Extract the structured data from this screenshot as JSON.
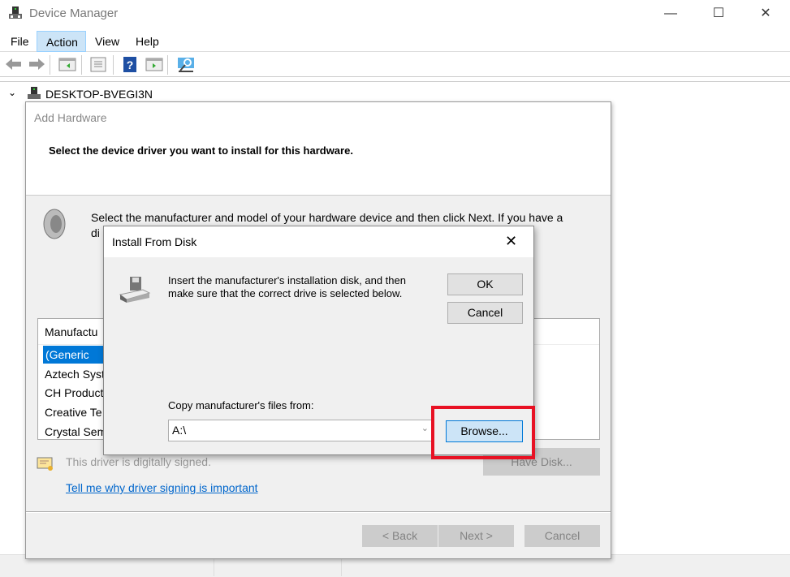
{
  "window": {
    "title": "Device Manager",
    "min": "—",
    "max": "☐",
    "close": "✕"
  },
  "menu": [
    {
      "label": "File"
    },
    {
      "label": "Action"
    },
    {
      "label": "View"
    },
    {
      "label": "Help"
    }
  ],
  "tree": {
    "expander": "⌄",
    "root": "DESKTOP-BVEGI3N"
  },
  "add_hardware": {
    "title": "Add Hardware",
    "heading": "Select the device driver you want to install for this hardware.",
    "instruction_1": "Select the manufacturer and model of your hardware device and then click Next. If you have a",
    "instruction_2": "di",
    "list_header": "Manufactu",
    "manufacturers": [
      "(Generic US",
      "Aztech Syst",
      "CH Product",
      "Creative Te",
      "Crystal Sem"
    ],
    "signed_text": "This driver is digitally signed.",
    "signing_link": "Tell me why driver signing is important",
    "have_disk": "Have Disk...",
    "back": "< Back",
    "next": "Next >",
    "cancel": "Cancel"
  },
  "install_from_disk": {
    "title": "Install From Disk",
    "close": "✕",
    "message_1": "Insert the manufacturer's installation disk, and then",
    "message_2": "make sure that the correct drive is selected below.",
    "ok": "OK",
    "cancel": "Cancel",
    "copy_label": "Copy manufacturer's files from:",
    "path_value": "A:\\",
    "browse": "Browse...",
    "dropdown_arrow": "⌄"
  },
  "colors": {
    "highlight": "#e81123",
    "selection": "#0078d7",
    "link": "#0066cc"
  }
}
